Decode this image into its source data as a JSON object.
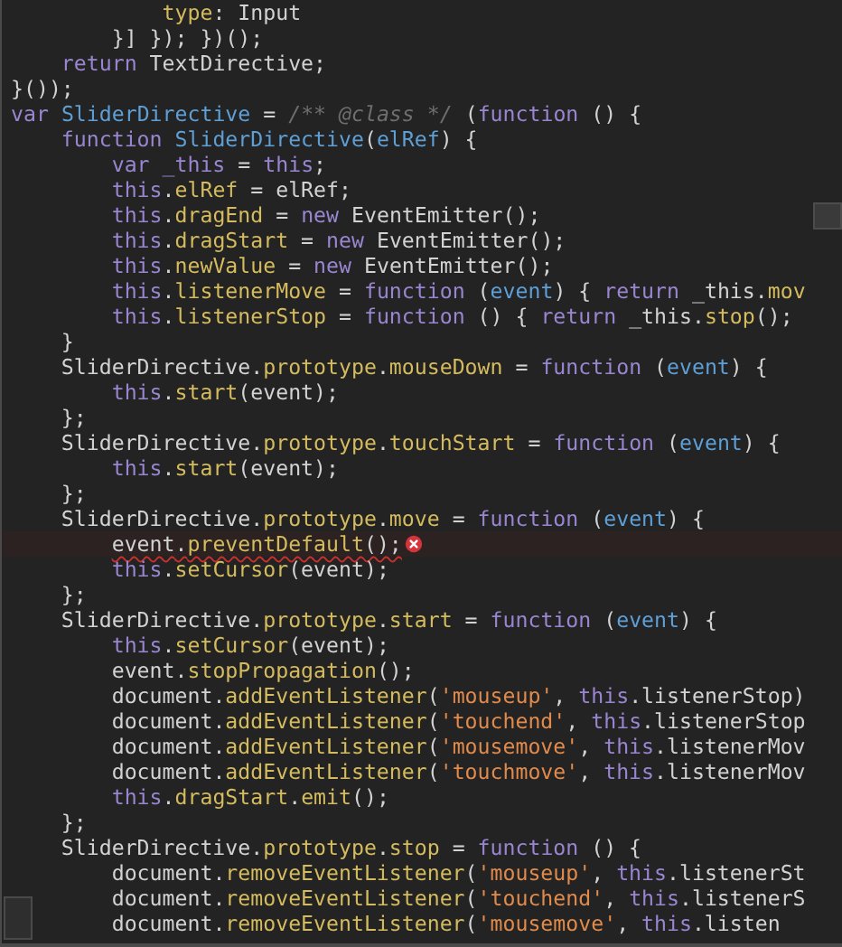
{
  "editor": {
    "lines": [
      {
        "tokens": [
          {
            "kind": "prop",
            "text": "            type"
          },
          {
            "kind": "plain",
            "text": ": Input"
          }
        ]
      },
      {
        "tokens": [
          {
            "kind": "plain",
            "text": "        }] }); })();"
          }
        ]
      },
      {
        "tokens": [
          {
            "kind": "keyword",
            "text": "    return"
          },
          {
            "kind": "plain",
            "text": " TextDirective;"
          }
        ]
      },
      {
        "tokens": [
          {
            "kind": "plain",
            "text": "}());"
          }
        ]
      },
      {
        "tokens": [
          {
            "kind": "keyword",
            "text": "var"
          },
          {
            "kind": "name",
            "text": " SliderDirective"
          },
          {
            "kind": "plain",
            "text": " = "
          },
          {
            "kind": "comment",
            "text": "/** @class */"
          },
          {
            "kind": "plain",
            "text": " ("
          },
          {
            "kind": "keyword",
            "text": "function"
          },
          {
            "kind": "plain",
            "text": " () {"
          }
        ]
      },
      {
        "tokens": [
          {
            "kind": "keyword",
            "text": "    function"
          },
          {
            "kind": "name",
            "text": " SliderDirective"
          },
          {
            "kind": "plain",
            "text": "("
          },
          {
            "kind": "name",
            "text": "elRef"
          },
          {
            "kind": "plain",
            "text": ") {"
          }
        ]
      },
      {
        "tokens": [
          {
            "kind": "keyword",
            "text": "        var _this"
          },
          {
            "kind": "plain",
            "text": " = "
          },
          {
            "kind": "keyword",
            "text": "this"
          },
          {
            "kind": "plain",
            "text": ";"
          }
        ]
      },
      {
        "tokens": [
          {
            "kind": "keyword",
            "text": "        this"
          },
          {
            "kind": "prop",
            "text": ".elRef"
          },
          {
            "kind": "plain",
            "text": " = elRef;"
          }
        ]
      },
      {
        "tokens": [
          {
            "kind": "keyword",
            "text": "        this"
          },
          {
            "kind": "prop",
            "text": ".dragEnd"
          },
          {
            "kind": "plain",
            "text": " = "
          },
          {
            "kind": "keyword",
            "text": "new"
          },
          {
            "kind": "plain",
            "text": " EventEmitter();"
          }
        ]
      },
      {
        "tokens": [
          {
            "kind": "keyword",
            "text": "        this"
          },
          {
            "kind": "prop",
            "text": ".dragStart"
          },
          {
            "kind": "plain",
            "text": " = "
          },
          {
            "kind": "keyword",
            "text": "new"
          },
          {
            "kind": "plain",
            "text": " EventEmitter();"
          }
        ]
      },
      {
        "tokens": [
          {
            "kind": "keyword",
            "text": "        this"
          },
          {
            "kind": "prop",
            "text": ".newValue"
          },
          {
            "kind": "plain",
            "text": " = "
          },
          {
            "kind": "keyword",
            "text": "new"
          },
          {
            "kind": "plain",
            "text": " EventEmitter();"
          }
        ]
      },
      {
        "tokens": [
          {
            "kind": "keyword",
            "text": "        this"
          },
          {
            "kind": "prop",
            "text": ".listenerMove"
          },
          {
            "kind": "plain",
            "text": " = "
          },
          {
            "kind": "keyword",
            "text": "function"
          },
          {
            "kind": "plain",
            "text": " ("
          },
          {
            "kind": "name",
            "text": "event"
          },
          {
            "kind": "plain",
            "text": ") { "
          },
          {
            "kind": "keyword",
            "text": "return"
          },
          {
            "kind": "plain",
            "text": " _this"
          },
          {
            "kind": "prop",
            "text": ".mov"
          }
        ]
      },
      {
        "tokens": [
          {
            "kind": "keyword",
            "text": "        this"
          },
          {
            "kind": "prop",
            "text": ".listenerStop"
          },
          {
            "kind": "plain",
            "text": " = "
          },
          {
            "kind": "keyword",
            "text": "function"
          },
          {
            "kind": "plain",
            "text": " () { "
          },
          {
            "kind": "keyword",
            "text": "return"
          },
          {
            "kind": "plain",
            "text": " _this"
          },
          {
            "kind": "prop",
            "text": ".stop"
          },
          {
            "kind": "plain",
            "text": "();"
          }
        ]
      },
      {
        "tokens": [
          {
            "kind": "plain",
            "text": "    }"
          }
        ]
      },
      {
        "tokens": [
          {
            "kind": "plain",
            "text": "    SliderDirective"
          },
          {
            "kind": "prop",
            "text": ".prototype"
          },
          {
            "kind": "prop",
            "text": ".mouseDown"
          },
          {
            "kind": "plain",
            "text": " = "
          },
          {
            "kind": "keyword",
            "text": "function"
          },
          {
            "kind": "plain",
            "text": " ("
          },
          {
            "kind": "name",
            "text": "event"
          },
          {
            "kind": "plain",
            "text": ") {"
          }
        ]
      },
      {
        "tokens": [
          {
            "kind": "keyword",
            "text": "        this"
          },
          {
            "kind": "prop",
            "text": ".start"
          },
          {
            "kind": "plain",
            "text": "(event);"
          }
        ]
      },
      {
        "tokens": [
          {
            "kind": "plain",
            "text": "    };"
          }
        ]
      },
      {
        "tokens": [
          {
            "kind": "plain",
            "text": "    SliderDirective"
          },
          {
            "kind": "prop",
            "text": ".prototype"
          },
          {
            "kind": "prop",
            "text": ".touchStart"
          },
          {
            "kind": "plain",
            "text": " = "
          },
          {
            "kind": "keyword",
            "text": "function"
          },
          {
            "kind": "plain",
            "text": " ("
          },
          {
            "kind": "name",
            "text": "event"
          },
          {
            "kind": "plain",
            "text": ") {"
          }
        ]
      },
      {
        "tokens": [
          {
            "kind": "keyword",
            "text": "        this"
          },
          {
            "kind": "prop",
            "text": ".start"
          },
          {
            "kind": "plain",
            "text": "(event);"
          }
        ]
      },
      {
        "tokens": [
          {
            "kind": "plain",
            "text": "    };"
          }
        ]
      },
      {
        "tokens": [
          {
            "kind": "plain",
            "text": "    SliderDirective"
          },
          {
            "kind": "prop",
            "text": ".prototype"
          },
          {
            "kind": "prop",
            "text": ".move"
          },
          {
            "kind": "plain",
            "text": " = "
          },
          {
            "kind": "keyword",
            "text": "function"
          },
          {
            "kind": "plain",
            "text": " ("
          },
          {
            "kind": "name",
            "text": "event"
          },
          {
            "kind": "plain",
            "text": ") {"
          }
        ]
      },
      {
        "error": true,
        "tokens": [
          {
            "kind": "plain",
            "text": "        event"
          },
          {
            "kind": "prop",
            "text": ".preventDefault"
          },
          {
            "kind": "plain",
            "text": "();"
          }
        ]
      },
      {
        "tokens": [
          {
            "kind": "keyword",
            "text": "        this"
          },
          {
            "kind": "prop",
            "text": ".setCursor"
          },
          {
            "kind": "plain",
            "text": "(event);"
          }
        ]
      },
      {
        "tokens": [
          {
            "kind": "plain",
            "text": "    };"
          }
        ]
      },
      {
        "tokens": [
          {
            "kind": "plain",
            "text": "    SliderDirective"
          },
          {
            "kind": "prop",
            "text": ".prototype"
          },
          {
            "kind": "prop",
            "text": ".start"
          },
          {
            "kind": "plain",
            "text": " = "
          },
          {
            "kind": "keyword",
            "text": "function"
          },
          {
            "kind": "plain",
            "text": " ("
          },
          {
            "kind": "name",
            "text": "event"
          },
          {
            "kind": "plain",
            "text": ") {"
          }
        ]
      },
      {
        "tokens": [
          {
            "kind": "keyword",
            "text": "        this"
          },
          {
            "kind": "prop",
            "text": ".setCursor"
          },
          {
            "kind": "plain",
            "text": "(event);"
          }
        ]
      },
      {
        "tokens": [
          {
            "kind": "plain",
            "text": "        event"
          },
          {
            "kind": "prop",
            "text": ".stopPropagation"
          },
          {
            "kind": "plain",
            "text": "();"
          }
        ]
      },
      {
        "tokens": [
          {
            "kind": "plain",
            "text": "        document"
          },
          {
            "kind": "prop",
            "text": ".addEventListener"
          },
          {
            "kind": "plain",
            "text": "("
          },
          {
            "kind": "string",
            "text": "'mouseup'"
          },
          {
            "kind": "plain",
            "text": ", "
          },
          {
            "kind": "keyword",
            "text": "this"
          },
          {
            "kind": "plain",
            "text": ".listenerStop)"
          }
        ]
      },
      {
        "tokens": [
          {
            "kind": "plain",
            "text": "        document"
          },
          {
            "kind": "prop",
            "text": ".addEventListener"
          },
          {
            "kind": "plain",
            "text": "("
          },
          {
            "kind": "string",
            "text": "'touchend'"
          },
          {
            "kind": "plain",
            "text": ", "
          },
          {
            "kind": "keyword",
            "text": "this"
          },
          {
            "kind": "plain",
            "text": ".listenerStop"
          }
        ]
      },
      {
        "tokens": [
          {
            "kind": "plain",
            "text": "        document"
          },
          {
            "kind": "prop",
            "text": ".addEventListener"
          },
          {
            "kind": "plain",
            "text": "("
          },
          {
            "kind": "string",
            "text": "'mousemove'"
          },
          {
            "kind": "plain",
            "text": ", "
          },
          {
            "kind": "keyword",
            "text": "this"
          },
          {
            "kind": "plain",
            "text": ".listenerMov"
          }
        ]
      },
      {
        "tokens": [
          {
            "kind": "plain",
            "text": "        document"
          },
          {
            "kind": "prop",
            "text": ".addEventListener"
          },
          {
            "kind": "plain",
            "text": "("
          },
          {
            "kind": "string",
            "text": "'touchmove'"
          },
          {
            "kind": "plain",
            "text": ", "
          },
          {
            "kind": "keyword",
            "text": "this"
          },
          {
            "kind": "plain",
            "text": ".listenerMov"
          }
        ]
      },
      {
        "tokens": [
          {
            "kind": "keyword",
            "text": "        this"
          },
          {
            "kind": "prop",
            "text": ".dragStart"
          },
          {
            "kind": "prop",
            "text": ".emit"
          },
          {
            "kind": "plain",
            "text": "();"
          }
        ]
      },
      {
        "tokens": [
          {
            "kind": "plain",
            "text": "    };"
          }
        ]
      },
      {
        "tokens": [
          {
            "kind": "plain",
            "text": "    SliderDirective"
          },
          {
            "kind": "prop",
            "text": ".prototype"
          },
          {
            "kind": "prop",
            "text": ".stop"
          },
          {
            "kind": "plain",
            "text": " = "
          },
          {
            "kind": "keyword",
            "text": "function"
          },
          {
            "kind": "plain",
            "text": " () {"
          }
        ]
      },
      {
        "tokens": [
          {
            "kind": "plain",
            "text": "        document"
          },
          {
            "kind": "prop",
            "text": ".removeEventListener"
          },
          {
            "kind": "plain",
            "text": "("
          },
          {
            "kind": "string",
            "text": "'mouseup'"
          },
          {
            "kind": "plain",
            "text": ", "
          },
          {
            "kind": "keyword",
            "text": "this"
          },
          {
            "kind": "plain",
            "text": ".listenerSt"
          }
        ]
      },
      {
        "tokens": [
          {
            "kind": "plain",
            "text": "        document"
          },
          {
            "kind": "prop",
            "text": ".removeEventListener"
          },
          {
            "kind": "plain",
            "text": "("
          },
          {
            "kind": "string",
            "text": "'touchend'"
          },
          {
            "kind": "plain",
            "text": ", "
          },
          {
            "kind": "keyword",
            "text": "this"
          },
          {
            "kind": "plain",
            "text": ".listenerS"
          }
        ]
      },
      {
        "tokens": [
          {
            "kind": "plain",
            "text": "        document"
          },
          {
            "kind": "prop",
            "text": ".removeEventListener"
          },
          {
            "kind": "plain",
            "text": "("
          },
          {
            "kind": "string",
            "text": "'mousemove'"
          },
          {
            "kind": "plain",
            "text": ", "
          },
          {
            "kind": "keyword",
            "text": "this"
          },
          {
            "kind": "plain",
            "text": ".listen"
          }
        ]
      }
    ]
  }
}
